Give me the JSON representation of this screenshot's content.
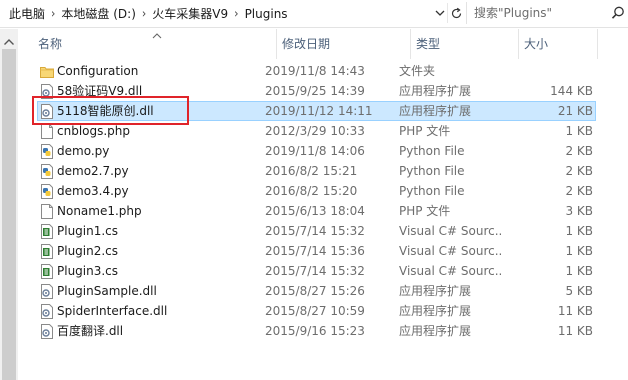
{
  "address_bar": {
    "crumbs": [
      "此电脑",
      "本地磁盘 (D:)",
      "火车采集器V9",
      "Plugins"
    ],
    "separator": "›"
  },
  "search": {
    "placeholder": "搜索\"Plugins\""
  },
  "columns": {
    "name": "名称",
    "date": "修改日期",
    "type": "类型",
    "size": "大小"
  },
  "files": [
    {
      "icon": "folder-icon",
      "name": "Configuration",
      "date": "2019/11/8 14:43",
      "type": "文件夹",
      "size": ""
    },
    {
      "icon": "dll-file-icon",
      "name": "58验证码V9.dll",
      "date": "2015/9/25 14:39",
      "type": "应用程序扩展",
      "size": "144 KB"
    },
    {
      "icon": "dll-file-icon",
      "name": "5118智能原创.dll",
      "date": "2019/11/12 14:11",
      "type": "应用程序扩展",
      "size": "21 KB",
      "selected": true
    },
    {
      "icon": "blank-file-icon",
      "name": "cnblogs.php",
      "date": "2012/3/29 10:33",
      "type": "PHP 文件",
      "size": "1 KB"
    },
    {
      "icon": "python-file-icon",
      "name": "demo.py",
      "date": "2019/11/8 14:06",
      "type": "Python File",
      "size": "2 KB"
    },
    {
      "icon": "python-file-icon",
      "name": "demo2.7.py",
      "date": "2016/8/2 15:21",
      "type": "Python File",
      "size": "2 KB"
    },
    {
      "icon": "python-file-icon",
      "name": "demo3.4.py",
      "date": "2016/8/2 15:20",
      "type": "Python File",
      "size": "2 KB"
    },
    {
      "icon": "blank-file-icon",
      "name": "Noname1.php",
      "date": "2015/6/13 18:04",
      "type": "PHP 文件",
      "size": "3 KB"
    },
    {
      "icon": "csharp-file-icon",
      "name": "Plugin1.cs",
      "date": "2015/7/14 15:32",
      "type": "Visual C# Sourc...",
      "size": "1 KB"
    },
    {
      "icon": "csharp-file-icon",
      "name": "Plugin2.cs",
      "date": "2015/7/14 15:36",
      "type": "Visual C# Sourc...",
      "size": "1 KB"
    },
    {
      "icon": "csharp-file-icon",
      "name": "Plugin3.cs",
      "date": "2015/7/14 15:32",
      "type": "Visual C# Sourc...",
      "size": "1 KB"
    },
    {
      "icon": "dll-file-icon",
      "name": "PluginSample.dll",
      "date": "2015/8/27 15:26",
      "type": "应用程序扩展",
      "size": "5 KB"
    },
    {
      "icon": "dll-file-icon",
      "name": "SpiderInterface.dll",
      "date": "2015/8/27 10:59",
      "type": "应用程序扩展",
      "size": "11 KB"
    },
    {
      "icon": "dll-file-icon",
      "name": "百度翻译.dll",
      "date": "2015/9/16 15:23",
      "type": "应用程序扩展",
      "size": "11 KB"
    }
  ],
  "colors": {
    "selection": "#cce8ff",
    "selection_border": "#99d1ff",
    "highlight_box": "#e0242a"
  }
}
